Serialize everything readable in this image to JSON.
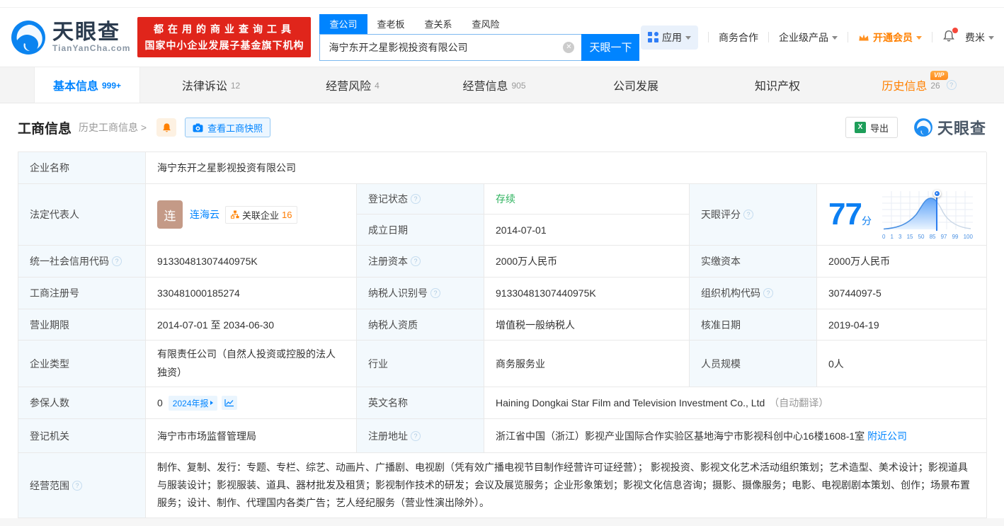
{
  "header": {
    "logo": {
      "title": "天眼查",
      "domain": "TianYanCha.com"
    },
    "banner": {
      "line1": "都在用的商业查询工具",
      "line2": "国家中小企业发展子基金旗下机构"
    },
    "search": {
      "tabs": [
        {
          "label": "查公司"
        },
        {
          "label": "查老板"
        },
        {
          "label": "查关系"
        },
        {
          "label": "查风险"
        }
      ],
      "value": "海宁东开之星影视投资有限公司",
      "button": "天眼一下"
    },
    "menu": {
      "apps": "应用",
      "cooperation": "商务合作",
      "enterprise": "企业级产品",
      "vip": "开通会员",
      "user": "费米"
    }
  },
  "nav_tabs": [
    {
      "label": "基本信息",
      "count": "999+"
    },
    {
      "label": "法律诉讼",
      "count": "12"
    },
    {
      "label": "经营风险",
      "count": "4"
    },
    {
      "label": "经营信息",
      "count": "905"
    },
    {
      "label": "公司发展",
      "count": ""
    },
    {
      "label": "知识产权",
      "count": ""
    },
    {
      "label": "历史信息",
      "count": "26",
      "vip": "VIP"
    }
  ],
  "section": {
    "title": "工商信息",
    "history_link": "历史工商信息 >",
    "snapshot_button": "查看工商快照",
    "export_button": "导出",
    "watermark": "天眼查"
  },
  "company": {
    "company_name": {
      "label": "企业名称",
      "value": "海宁东开之星影视投资有限公司"
    },
    "legal_rep": {
      "label": "法定代表人",
      "avatar": "连",
      "name": "连海云",
      "related_label": "关联企业",
      "related_count": "16"
    },
    "reg_status": {
      "label": "登记状态",
      "value": "存续"
    },
    "establish_date": {
      "label": "成立日期",
      "value": "2014-07-01"
    },
    "credit_code": {
      "label": "统一社会信用代码",
      "value": "91330481307440975K"
    },
    "reg_capital": {
      "label": "注册资本",
      "value": "2000万人民币"
    },
    "paid_capital": {
      "label": "实缴资本",
      "value": "2000万人民币"
    },
    "reg_number": {
      "label": "工商注册号",
      "value": "330481000185274"
    },
    "taxpayer_id": {
      "label": "纳税人识别号",
      "value": "91330481307440975K"
    },
    "org_code": {
      "label": "组织机构代码",
      "value": "30744097-5"
    },
    "business_term": {
      "label": "营业期限",
      "value": "2014-07-01 至 2034-06-30"
    },
    "taxpayer_quality": {
      "label": "纳税人资质",
      "value": "增值税一般纳税人"
    },
    "approval_date": {
      "label": "核准日期",
      "value": "2019-04-19"
    },
    "company_type": {
      "label": "企业类型",
      "value": "有限责任公司（自然人投资或控股的法人独资）"
    },
    "industry": {
      "label": "行业",
      "value": "商务服务业"
    },
    "staff_size": {
      "label": "人员规模",
      "value": "0人"
    },
    "insured": {
      "label": "参保人数",
      "value": "0",
      "badge": "2024年报"
    },
    "english_name": {
      "label": "英文名称",
      "value": "Haining Dongkai Star Film and Television Investment Co., Ltd",
      "note": "（自动翻译）"
    },
    "reg_authority": {
      "label": "登记机关",
      "value": "海宁市市场监督管理局"
    },
    "reg_address": {
      "label": "注册地址",
      "value": "浙江省中国（浙江）影视产业国际合作实验区基地海宁市影视科创中心16楼1608-1室",
      "nearby": "附近公司"
    },
    "business_scope": {
      "label": "经营范围",
      "value": "制作、复制、发行：专题、专栏、综艺、动画片、广播剧、电视剧（凭有效广播电视节目制作经营许可证经营）； 影视投资、影视文化艺术活动组织策划；艺术造型、美术设计；影视道具与服装设计；影视服装、道具、器材批发及租赁；影视制作技术的研发；会议及展览服务；企业形象策划；影视文化信息咨询；摄影、摄像服务；电影、电视剧剧本策划、创作；场景布置服务；设计、制作、代理国内各类广告；艺人经纪服务（营业性演出除外）。"
    }
  },
  "score": {
    "label": "天眼评分",
    "value": "77",
    "unit": "分",
    "ticks": [
      "0",
      "1",
      "3",
      "15",
      "50",
      "85",
      "97",
      "99",
      "100"
    ]
  },
  "colors": {
    "accent_blue": "#0084ff",
    "banner_red": "#e0251b",
    "status_green": "#2fb35f",
    "vip_orange": "#ff8000"
  }
}
